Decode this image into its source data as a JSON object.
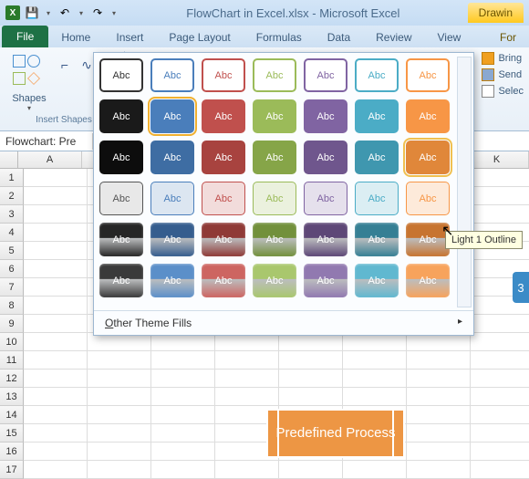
{
  "titlebar": {
    "filename": "FlowChart in Excel.xlsx - Microsoft Excel",
    "context_tab": "Drawin"
  },
  "qat": {
    "excel": "X",
    "save_icon": "💾",
    "undo_icon": "↶",
    "redo_icon": "↷"
  },
  "tabs": {
    "file": "File",
    "home": "Home",
    "insert": "Insert",
    "page_layout": "Page Layout",
    "formulas": "Formulas",
    "data": "Data",
    "review": "Review",
    "view": "View",
    "format": "For"
  },
  "ribbon": {
    "shapes_label": "Shapes",
    "insert_shapes_group": "Insert Shapes",
    "arrange": {
      "bring": "Bring",
      "send": "Send",
      "select": "Selec"
    }
  },
  "formula_bar": {
    "name_box": "Flowchart: Pre"
  },
  "columns": [
    "A",
    "",
    "",
    "",
    "",
    "",
    "",
    "K"
  ],
  "rows": [
    "1",
    "2",
    "3",
    "4",
    "5",
    "6",
    "7",
    "8",
    "9",
    "10",
    "11",
    "12",
    "13",
    "14",
    "15",
    "16",
    "17"
  ],
  "gallery": {
    "swatch_text": "Abc",
    "other_fills": "Other Theme Fills",
    "rows": [
      {
        "style": "outline",
        "colors": [
          "#ffffff",
          "#ffffff",
          "#ffffff",
          "#ffffff",
          "#ffffff",
          "#ffffff",
          "#ffffff"
        ],
        "borders": [
          "#333333",
          "#4a7ebb",
          "#c0504d",
          "#9bbb59",
          "#8064a2",
          "#4bacc6",
          "#f79646"
        ],
        "text": [
          "#333",
          "#4a7ebb",
          "#c0504d",
          "#9bbb59",
          "#8064a2",
          "#4bacc6",
          "#f79646"
        ]
      },
      {
        "style": "solid",
        "colors": [
          "#1a1a1a",
          "#4a7ebb",
          "#c0504d",
          "#9bbb59",
          "#8064a2",
          "#4bacc6",
          "#f79646"
        ],
        "text": [
          "#fff",
          "#fff",
          "#fff",
          "#fff",
          "#fff",
          "#fff",
          "#fff"
        ],
        "sel": 1
      },
      {
        "style": "solid-light",
        "colors": [
          "#0d0d0d",
          "#3e6da3",
          "#a8433f",
          "#86a548",
          "#6f568d",
          "#3f97af",
          "#e0873a"
        ],
        "text": [
          "#fff",
          "#fff",
          "#fff",
          "#fff",
          "#fff",
          "#fff",
          "#fff"
        ],
        "hov": 6
      },
      {
        "style": "light",
        "colors": [
          "#e8e8e8",
          "#dce6f1",
          "#f2dcdb",
          "#ebf1de",
          "#e5e0ec",
          "#dbeef3",
          "#fdeada"
        ],
        "text": [
          "#555",
          "#4a7ebb",
          "#c0504d",
          "#9bbb59",
          "#8064a2",
          "#4bacc6",
          "#f79646"
        ]
      },
      {
        "style": "gloss-dark",
        "colors": [
          "#262626",
          "#355d8e",
          "#8f3a37",
          "#72903c",
          "#5d4777",
          "#357f94",
          "#c77430"
        ],
        "text": [
          "#fff",
          "#fff",
          "#fff",
          "#fff",
          "#fff",
          "#fff",
          "#fff"
        ]
      },
      {
        "style": "gloss",
        "colors": [
          "#3a3a3a",
          "#5b8fc9",
          "#cd6561",
          "#a9c76d",
          "#9179b0",
          "#60b8d0",
          "#f7a35c"
        ],
        "text": [
          "#fff",
          "#fff",
          "#fff",
          "#fff",
          "#fff",
          "#fff",
          "#fff"
        ]
      }
    ]
  },
  "tooltip": "Light 1 Outline",
  "predefined_shape": "Predefined Process",
  "right_shape_text": "3"
}
